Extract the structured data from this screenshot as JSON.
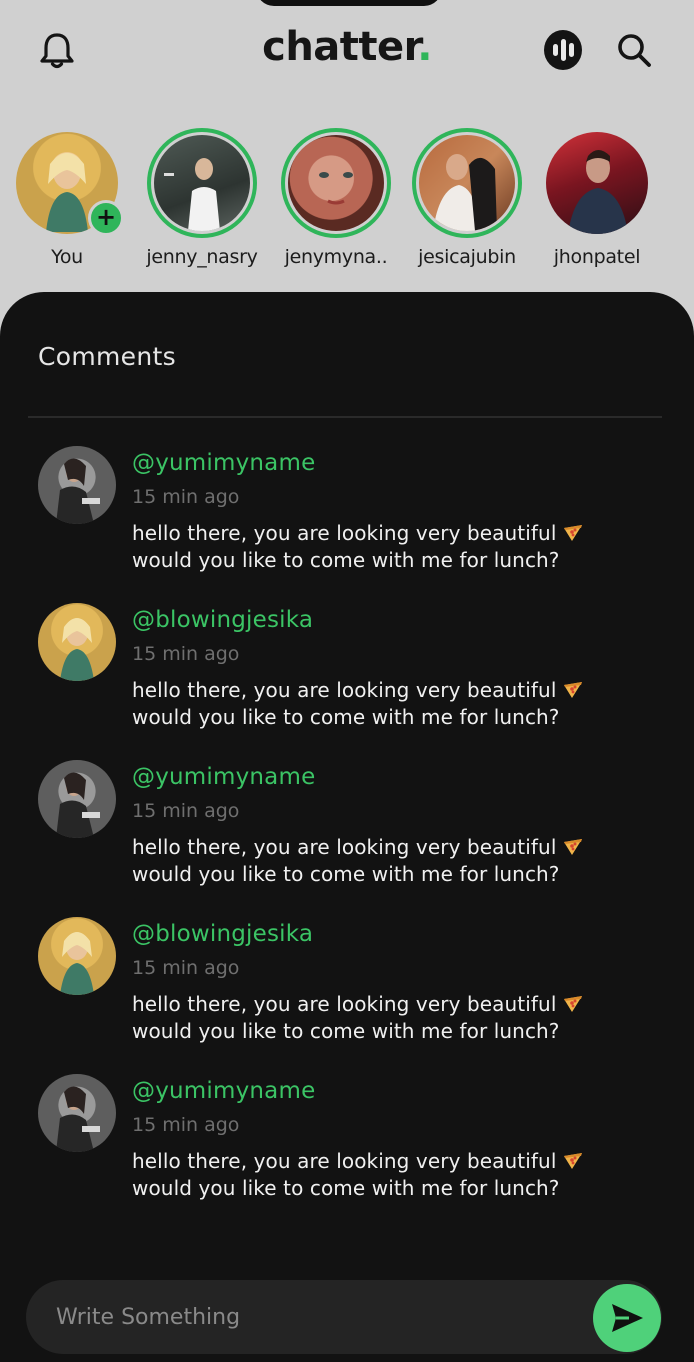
{
  "app": {
    "brand": "chatter",
    "brand_dot": ".",
    "accent": "#2fb55a"
  },
  "header": {
    "left_icon": "bell-icon",
    "right_icons": [
      "audio-wave-icon",
      "search-icon"
    ]
  },
  "stories": [
    {
      "label": "You",
      "icon": "add-icon",
      "add": "+"
    },
    {
      "label": "jenny_nasry"
    },
    {
      "label": "jenymyna.."
    },
    {
      "label": "jesicajubin"
    },
    {
      "label": "jhonpatel"
    }
  ],
  "comments_sheet": {
    "title": "Comments",
    "items": [
      {
        "handle": "@yumimyname",
        "time": "15 min ago",
        "line1": "hello there, you are looking very beautiful",
        "line2": "would you like to come with me for lunch?",
        "emoji": "pizza-icon"
      },
      {
        "handle": "@blowingjesika",
        "time": "15 min ago",
        "line1": "hello there, you are looking very beautiful",
        "line2": "would you like to come with me for lunch?",
        "emoji": "pizza-icon"
      },
      {
        "handle": "@yumimyname",
        "time": "15 min ago",
        "line1": "hello there, you are looking very beautiful",
        "line2": "would you like to come with me for lunch?",
        "emoji": "pizza-icon"
      },
      {
        "handle": "@blowingjesika",
        "time": "15 min ago",
        "line1": "hello there, you are looking very beautiful",
        "line2": "would you like to come with me for lunch?",
        "emoji": "pizza-icon"
      },
      {
        "handle": "@yumimyname",
        "time": "15 min ago",
        "line1": "hello there, you are looking very beautiful",
        "line2": "would you like to come with me for lunch?",
        "emoji": "pizza-icon"
      }
    ]
  },
  "composer": {
    "placeholder": "Write Something",
    "send_icon": "send-icon"
  }
}
